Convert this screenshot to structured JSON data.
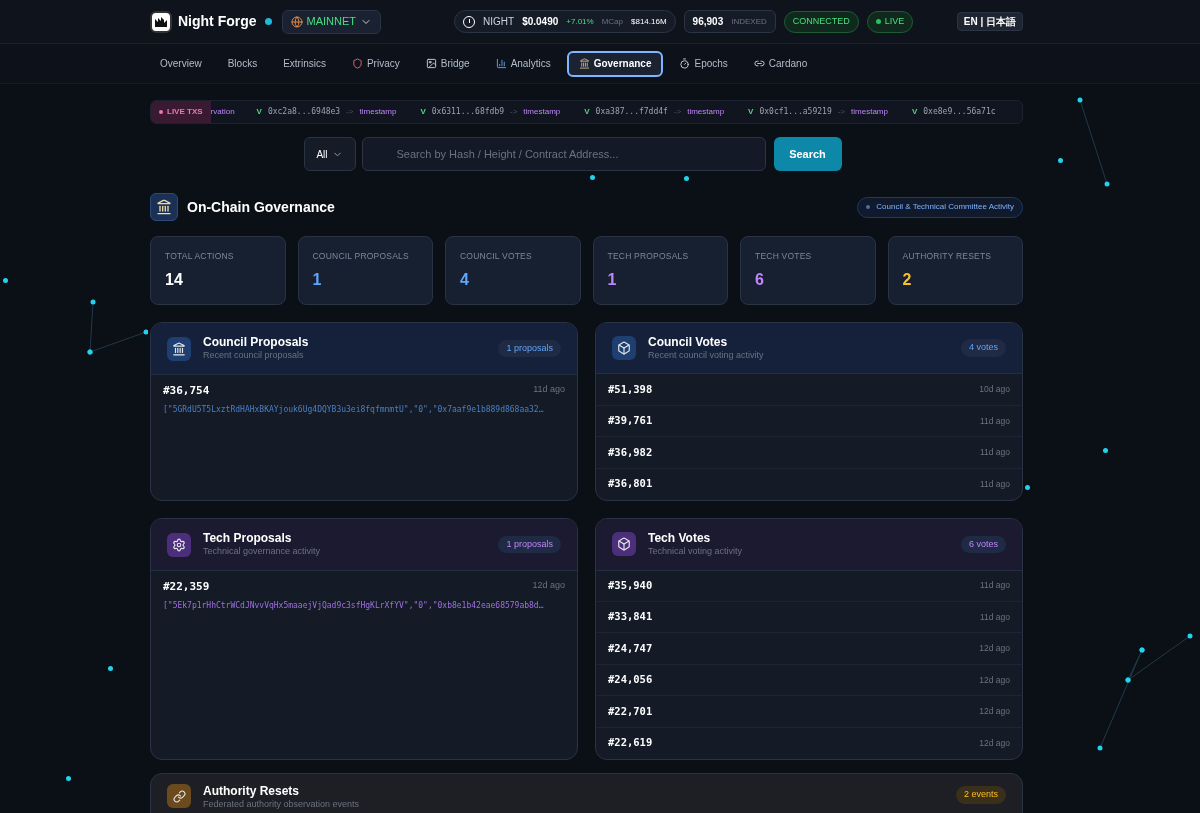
{
  "header": {
    "brand": "Night Forge",
    "network": "MAINNET",
    "token": {
      "symbol": "NIGHT",
      "price": "$0.0490",
      "change": "+7.01%",
      "mcap_label": "MCap",
      "mcap": "$814.16M"
    },
    "indexed": {
      "count": "96,903",
      "label": "INDEXED"
    },
    "connection": "CONNECTED",
    "live": "LIVE",
    "language": "EN | 日本語"
  },
  "nav": [
    {
      "label": "Overview",
      "kind": "plain",
      "selected": false
    },
    {
      "label": "Blocks",
      "kind": "plain",
      "selected": false
    },
    {
      "label": "Extrinsics",
      "kind": "plain",
      "selected": false
    },
    {
      "label": "Privacy",
      "kind": "shield",
      "selected": false
    },
    {
      "label": "Bridge",
      "kind": "image",
      "selected": false
    },
    {
      "label": "Analytics",
      "kind": "chart",
      "selected": false
    },
    {
      "label": "Governance",
      "kind": "landmark",
      "selected": true
    },
    {
      "label": "Epochs",
      "kind": "timer",
      "selected": false
    },
    {
      "label": "Cardano",
      "kind": "link",
      "selected": false
    }
  ],
  "ticker": {
    "label": "LIVE TXS",
    "lead": "rvation",
    "items": [
      {
        "status": "V",
        "hash": "0xc2a8...6948e3",
        "arrow": "->",
        "method": "timestamp"
      },
      {
        "status": "V",
        "hash": "0x6311...68fdb9",
        "arrow": "->",
        "method": "timestamp"
      },
      {
        "status": "V",
        "hash": "0xa387...f7dd4f",
        "arrow": "->",
        "method": "timestamp"
      },
      {
        "status": "V",
        "hash": "0x0cf1...a59219",
        "arrow": "->",
        "method": "timestamp"
      },
      {
        "status": "V",
        "hash": "0xe8e9...56a71c"
      }
    ]
  },
  "search": {
    "filter": "All",
    "placeholder": "Search by Hash / Height / Contract Address...",
    "button": "Search"
  },
  "page": {
    "title": "On-Chain Governance",
    "badge": "Council & Technical Committee Activity"
  },
  "stats": [
    {
      "label": "TOTAL ACTIONS",
      "value": "14",
      "color": "#ffffff"
    },
    {
      "label": "COUNCIL PROPOSALS",
      "value": "1",
      "color": "#60a5fa"
    },
    {
      "label": "COUNCIL VOTES",
      "value": "4",
      "color": "#60a5fa"
    },
    {
      "label": "TECH PROPOSALS",
      "value": "1",
      "color": "#c084fc"
    },
    {
      "label": "TECH VOTES",
      "value": "6",
      "color": "#c084fc"
    },
    {
      "label": "AUTHORITY RESETS",
      "value": "2",
      "color": "#fbbf24"
    }
  ],
  "panels": [
    {
      "title": "Council Proposals",
      "subtitle": "Recent council proposals",
      "count": "1 proposals",
      "kind": "proposals",
      "rows": [
        {
          "id": "#36,754",
          "time": "11d ago",
          "args": "[\"5GRdU5T5LxztRdHAHxBKAYjouk6Ug4DQYB3u3ei8fqfmnmtU\",\"0\",\"0x7aaf9e1b889d868aa32…"
        }
      ]
    },
    {
      "title": "Council Votes",
      "subtitle": "Recent council voting activity",
      "count": "4 votes",
      "kind": "votes",
      "rows": [
        {
          "id": "#51,398",
          "time": "10d ago"
        },
        {
          "id": "#39,761",
          "time": "11d ago"
        },
        {
          "id": "#36,982",
          "time": "11d ago"
        },
        {
          "id": "#36,801",
          "time": "11d ago"
        }
      ]
    },
    {
      "title": "Tech Proposals",
      "subtitle": "Technical governance activity",
      "count": "1 proposals",
      "kind": "proposals",
      "rows": [
        {
          "id": "#22,359",
          "time": "12d ago",
          "args": "[\"5Ek7p1rHhCtrWCdJNvvVqHx5maaejVjQad9c3sfHgKLrXfYV\",\"0\",\"0xb8e1b42eae68579ab8d…"
        }
      ]
    },
    {
      "title": "Tech Votes",
      "subtitle": "Technical voting activity",
      "count": "6 votes",
      "kind": "votes",
      "rows": [
        {
          "id": "#35,940",
          "time": "11d ago"
        },
        {
          "id": "#33,841",
          "time": "11d ago"
        },
        {
          "id": "#24,747",
          "time": "12d ago"
        },
        {
          "id": "#24,056",
          "time": "12d ago"
        },
        {
          "id": "#22,701",
          "time": "12d ago"
        },
        {
          "id": "#22,619",
          "time": "12d ago"
        }
      ]
    }
  ],
  "resets": {
    "title": "Authority Resets",
    "subtitle": "Federated authority observation events",
    "count": "2 events"
  }
}
